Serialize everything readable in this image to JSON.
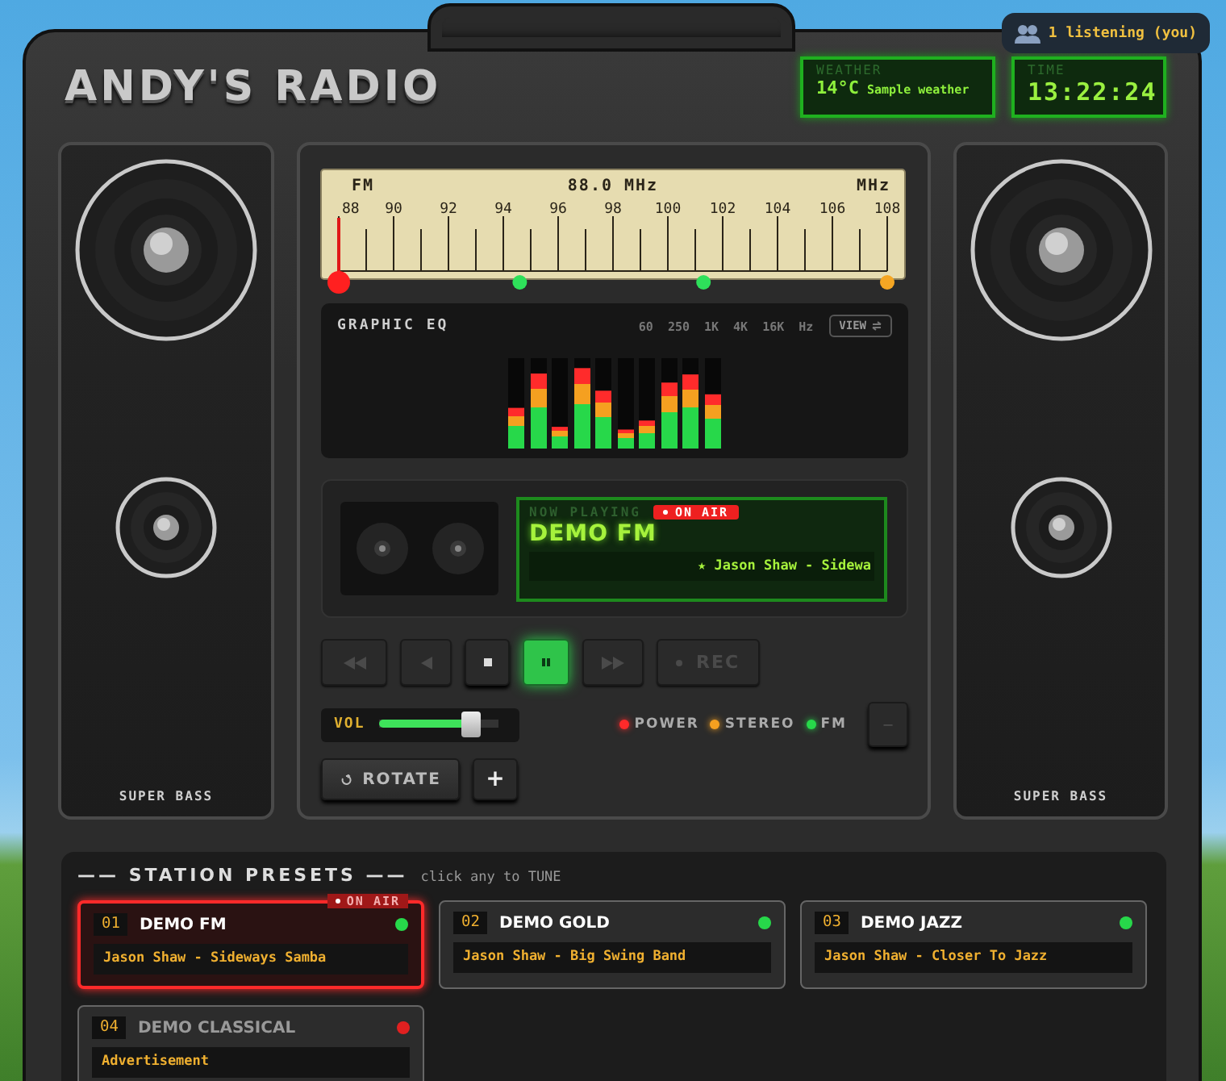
{
  "header": {
    "title": "ANDY'S RADIO",
    "listeners": "1 listening (you)"
  },
  "weather": {
    "label": "WEATHER",
    "temperature": "14°C",
    "description": "Sample weather"
  },
  "clock": {
    "label": "TIME",
    "time": "13:22:24"
  },
  "speakers": [
    {
      "label": "SUPER BASS"
    },
    {
      "label": "SUPER BASS"
    }
  ],
  "dial": {
    "band": "FM",
    "frequency": "88.0 MHz",
    "unit": "MHz",
    "scale": [
      "88",
      "90",
      "92",
      "94",
      "96",
      "98",
      "100",
      "102",
      "104",
      "106",
      "108"
    ],
    "needle": {
      "level": 0
    },
    "markers": [
      {
        "color": "#2ee05a",
        "level": 0.33
      },
      {
        "color": "#2ee05a",
        "level": 0.665
      },
      {
        "color": "#f5a623",
        "level": 1
      }
    ]
  },
  "equalizer": {
    "title": "GRAPHIC EQ",
    "bands": [
      "60",
      "250",
      "1K",
      "4K",
      "16K"
    ],
    "unit": "Hz",
    "view_button": "VIEW",
    "bars": [
      {
        "level": 0.45
      },
      {
        "level": 0.83
      },
      {
        "level": 0.24
      },
      {
        "level": 0.89
      },
      {
        "level": 0.64
      },
      {
        "level": 0.21
      },
      {
        "level": 0.31
      },
      {
        "level": 0.73
      },
      {
        "level": 0.82
      },
      {
        "level": 0.6
      }
    ]
  },
  "now_playing": {
    "label": "NOW PLAYING",
    "badge": "ON AIR",
    "station": "DEMO FM",
    "ticker": "★ Jason Shaw - Sidewa"
  },
  "transport": [
    {
      "kind": "rewind",
      "disabled": true,
      "selected": false
    },
    {
      "kind": "previous",
      "disabled": true,
      "selected": false
    },
    {
      "kind": "stop",
      "disabled": false,
      "selected": false
    },
    {
      "kind": "pause",
      "disabled": false,
      "selected": true
    },
    {
      "kind": "forward",
      "disabled": true,
      "selected": false
    },
    {
      "kind": "record",
      "label": "REC",
      "disabled": true,
      "selected": false
    }
  ],
  "volume": {
    "label": "VOL",
    "level": 0.76
  },
  "indicators": [
    {
      "label": "POWER",
      "color": "#ff2a2a"
    },
    {
      "label": "STEREO",
      "color": "#f5a020"
    },
    {
      "label": "FM",
      "color": "#27d84a"
    }
  ],
  "minus_button": "–",
  "rotate_button": "ROTATE",
  "add_button": "+",
  "presets": {
    "title": "—— STATION PRESETS ——",
    "hint": "click any to TUNE",
    "badge": "ON AIR",
    "items": [
      {
        "number": "01",
        "name": "DEMO FM",
        "track": "Jason Shaw - Sideways Samba",
        "color": "#27d84a",
        "selected": true,
        "disabled": false
      },
      {
        "number": "02",
        "name": "DEMO GOLD",
        "track": "Jason Shaw - Big Swing Band",
        "color": "#27d84a",
        "selected": false,
        "disabled": false
      },
      {
        "number": "03",
        "name": "DEMO JAZZ",
        "track": "Jason Shaw - Closer To Jazz",
        "color": "#27d84a",
        "selected": false,
        "disabled": false
      },
      {
        "number": "04",
        "name": "DEMO CLASSICAL",
        "track": "Advertisement",
        "color": "#e02020",
        "selected": false,
        "disabled": true
      }
    ]
  }
}
